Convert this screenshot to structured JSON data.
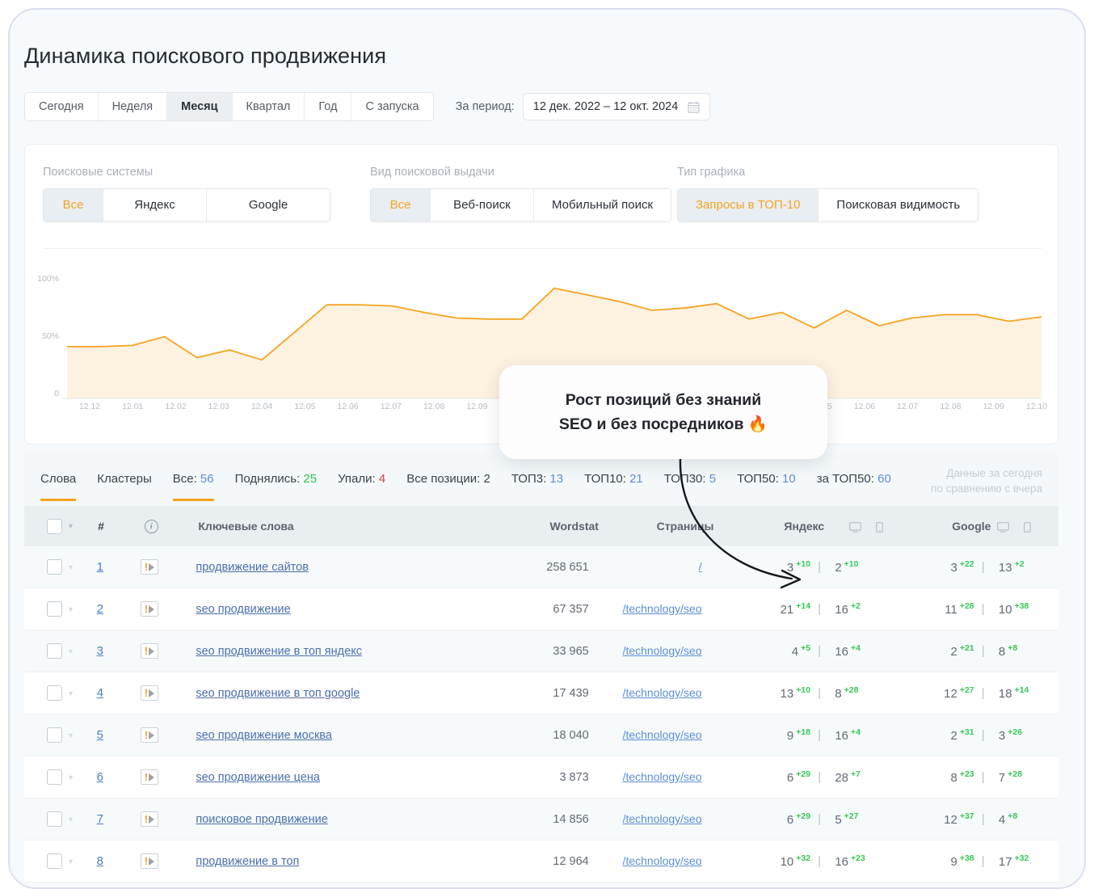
{
  "header": {
    "title": "Динамика поискового продвижения",
    "period_tabs": [
      {
        "label": "Сегодня",
        "active": false
      },
      {
        "label": "Неделя",
        "active": false
      },
      {
        "label": "Месяц",
        "active": true
      },
      {
        "label": "Квартал",
        "active": false
      },
      {
        "label": "Год",
        "active": false
      },
      {
        "label": "С запуска",
        "active": false
      }
    ],
    "period_label": "За период:",
    "date_range": "12 дек. 2022 – 12 окт. 2024",
    "calendar_icon": "calendar-icon"
  },
  "filters": [
    {
      "name": "search-engines",
      "label": "Поисковые системы",
      "options": [
        {
          "label": "Все",
          "selected": true,
          "w": "w1"
        },
        {
          "label": "Яндекс",
          "selected": false,
          "w": "w2"
        },
        {
          "label": "Google",
          "selected": false,
          "w": "w3"
        }
      ]
    },
    {
      "name": "serp-type",
      "label": "Вид поисковой выдачи",
      "options": [
        {
          "label": "Все",
          "selected": true,
          "w": "w1"
        },
        {
          "label": "Веб-поиск",
          "selected": false,
          "w": "w2"
        },
        {
          "label": "Мобильный поиск",
          "selected": false,
          "w": "w3"
        }
      ]
    },
    {
      "name": "chart-type",
      "label": "Тип графика",
      "options": [
        {
          "label": "Запросы в ТОП-10",
          "selected": true,
          "w": "w3"
        },
        {
          "label": "Поисковая видимость",
          "selected": false,
          "w": "w3"
        }
      ]
    }
  ],
  "chart_data": {
    "type": "area",
    "title": "",
    "xlabel": "",
    "ylabel": "",
    "ylim": [
      0,
      110
    ],
    "ytick_labels": [
      "100%",
      "50%",
      "0"
    ],
    "ytick_values": [
      100,
      50,
      0
    ],
    "grid": false,
    "legend": "none",
    "line_color": "#f5a320",
    "fill_color": "#fdf2e0",
    "x_tick_labels": [
      "12.12",
      "12.01",
      "12.02",
      "12.03",
      "12.04",
      "12.05",
      "12.06",
      "12.07",
      "12.08",
      "12.09",
      "12.10",
      "12.11",
      "12.12",
      "12.01",
      "12.02",
      "12.03",
      "12.04",
      "12.05",
      "12.06",
      "12.07",
      "12.08",
      "12.09",
      "12.10"
    ],
    "series": [
      {
        "name": "Запросы в ТОП-10",
        "values": [
          47,
          47,
          48,
          56,
          37,
          44,
          35,
          60,
          85,
          85,
          84,
          78,
          73,
          72,
          72,
          100,
          94,
          88,
          80,
          82,
          86,
          72,
          78,
          64,
          80,
          66,
          73,
          76,
          76,
          70,
          74
        ]
      }
    ]
  },
  "callout": {
    "line1": "Рост позиций без знаний",
    "line2": "SEO и без посредников 🔥"
  },
  "stats": [
    {
      "label": "Слова",
      "value": "",
      "color": "n-dark",
      "underlined": true
    },
    {
      "label": "Кластеры",
      "value": "",
      "color": "n-dark",
      "underlined": false
    },
    {
      "label": "Все:",
      "value": "56",
      "color": "n-blue",
      "underlined": true
    },
    {
      "label": "Поднялись:",
      "value": "25",
      "color": "n-green",
      "underlined": false
    },
    {
      "label": "Упали:",
      "value": "4",
      "color": "n-red",
      "underlined": false
    },
    {
      "label": "Все позиции:",
      "value": "2",
      "color": "n-dark",
      "underlined": false
    },
    {
      "label": "ТОП3:",
      "value": "13",
      "color": "n-blue",
      "underlined": false
    },
    {
      "label": "ТОП10:",
      "value": "21",
      "color": "n-blue",
      "underlined": false
    },
    {
      "label": "ТОП30:",
      "value": "5",
      "color": "n-blue",
      "underlined": false
    },
    {
      "label": "ТОП50:",
      "value": "10",
      "color": "n-blue",
      "underlined": false
    },
    {
      "label": "за ТОП50:",
      "value": "60",
      "color": "n-blue",
      "underlined": false
    }
  ],
  "today_note": {
    "line1": "Данные за сегодня",
    "line2": "по сравнению с вчера"
  },
  "table": {
    "headers": {
      "num": "#",
      "keywords": "Ключевые слова",
      "wordstat": "Wordstat",
      "pages": "Страницы",
      "yandex": "Яндекс",
      "google": "Google"
    },
    "rows": [
      {
        "num": "1",
        "keyword": "продвижение сайтов",
        "wordstat": "258 651",
        "page": "/",
        "ya_desk": "3",
        "ya_desk_d": "+10",
        "ya_mob": "2",
        "ya_mob_d": "+10",
        "gg_desk": "3",
        "gg_desk_d": "+22",
        "gg_mob": "13",
        "gg_mob_d": "+2"
      },
      {
        "num": "2",
        "keyword": "seo продвижение",
        "wordstat": "67 357",
        "page": "/technology/seo",
        "ya_desk": "21",
        "ya_desk_d": "+14",
        "ya_mob": "16",
        "ya_mob_d": "+2",
        "gg_desk": "11",
        "gg_desk_d": "+28",
        "gg_mob": "10",
        "gg_mob_d": "+38"
      },
      {
        "num": "3",
        "keyword": "seo продвижение в топ яндекс",
        "wordstat": "33 965",
        "page": "/technology/seo",
        "ya_desk": "4",
        "ya_desk_d": "+5",
        "ya_mob": "16",
        "ya_mob_d": "+4",
        "gg_desk": "2",
        "gg_desk_d": "+21",
        "gg_mob": "8",
        "gg_mob_d": "+8"
      },
      {
        "num": "4",
        "keyword": "seo продвижение в топ google",
        "wordstat": "17 439",
        "page": "/technology/seo",
        "ya_desk": "13",
        "ya_desk_d": "+10",
        "ya_mob": "8",
        "ya_mob_d": "+28",
        "gg_desk": "12",
        "gg_desk_d": "+27",
        "gg_mob": "18",
        "gg_mob_d": "+14"
      },
      {
        "num": "5",
        "keyword": "seo продвижение москва",
        "wordstat": "18 040",
        "page": "/technology/seo",
        "ya_desk": "9",
        "ya_desk_d": "+18",
        "ya_mob": "16",
        "ya_mob_d": "+4",
        "gg_desk": "2",
        "gg_desk_d": "+31",
        "gg_mob": "3",
        "gg_mob_d": "+26"
      },
      {
        "num": "6",
        "keyword": "seo продвижение цена",
        "wordstat": "3 873",
        "page": "/technology/seo",
        "ya_desk": "6",
        "ya_desk_d": "+29",
        "ya_mob": "28",
        "ya_mob_d": "+7",
        "gg_desk": "8",
        "gg_desk_d": "+23",
        "gg_mob": "7",
        "gg_mob_d": "+28"
      },
      {
        "num": "7",
        "keyword": "поисковое продвижение",
        "wordstat": "14 856",
        "page": "/technology/seo",
        "ya_desk": "6",
        "ya_desk_d": "+29",
        "ya_mob": "5",
        "ya_mob_d": "+27",
        "gg_desk": "12",
        "gg_desk_d": "+37",
        "gg_mob": "4",
        "gg_mob_d": "+8"
      },
      {
        "num": "8",
        "keyword": "продвижение в топ",
        "wordstat": "12 964",
        "page": "/technology/seo",
        "ya_desk": "10",
        "ya_desk_d": "+32",
        "ya_mob": "16",
        "ya_mob_d": "+23",
        "gg_desk": "9",
        "gg_desk_d": "+38",
        "gg_mob": "17",
        "gg_mob_d": "+32"
      }
    ]
  }
}
